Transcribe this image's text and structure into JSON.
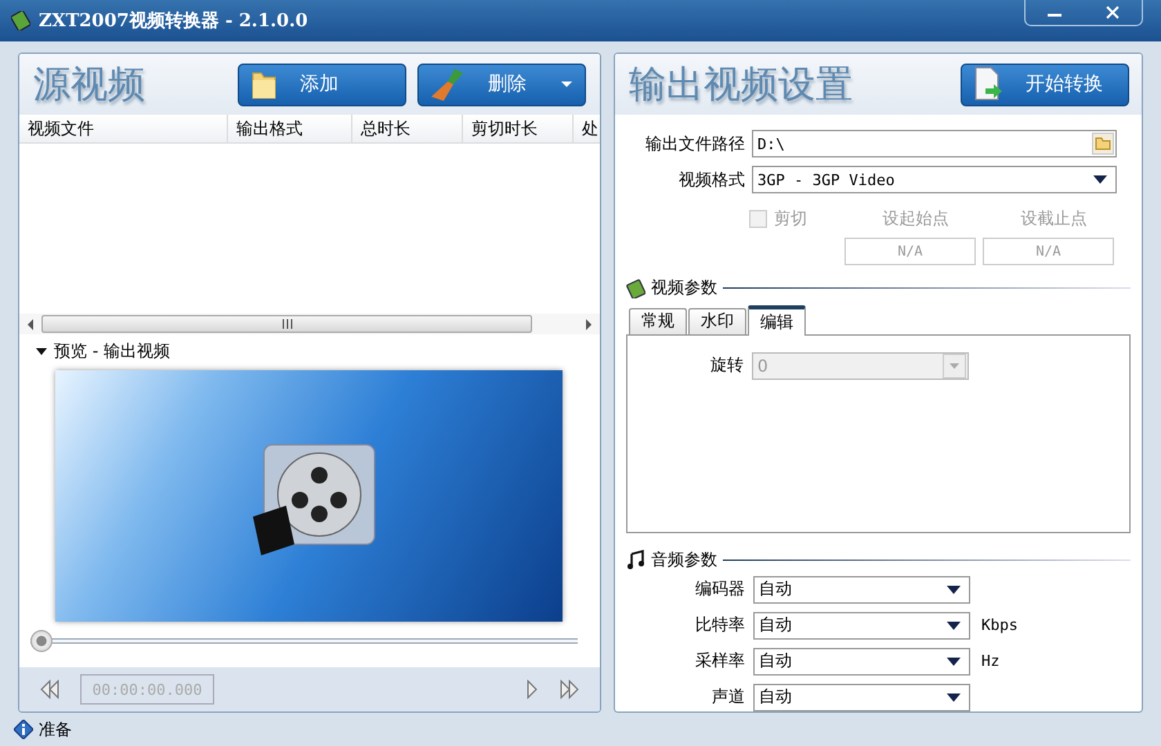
{
  "window": {
    "title": "ZXT2007视频转换器 - 2.1.0.0"
  },
  "source": {
    "title": "源视频",
    "buttons": [
      {
        "label": "添加",
        "kind": "add"
      },
      {
        "label": "删除",
        "kind": "delete"
      }
    ],
    "table": {
      "columns": [
        "视频文件",
        "输出格式",
        "总时长",
        "剪切时长",
        "处"
      ]
    },
    "preview": {
      "label": "预览 - 输出视频",
      "expanded": true,
      "seek": {
        "level": 0
      },
      "time": "00:00:00.000"
    }
  },
  "output": {
    "title": "输出视频设置",
    "start_button": "开始转换",
    "path": {
      "label": "输出文件路径",
      "value": "D:\\"
    },
    "format": {
      "label": "视频格式",
      "value": "3GP - 3GP Video"
    },
    "trim": {
      "label": "剪切",
      "checked": false,
      "disabled": true
    },
    "set_start": {
      "label": "设起始点",
      "value": "N/A"
    },
    "set_end": {
      "label": "设截止点",
      "value": "N/A"
    },
    "video_params": {
      "title": "视频参数",
      "tabs": [
        {
          "label": "常规",
          "selected": false
        },
        {
          "label": "水印",
          "selected": false
        },
        {
          "label": "编辑",
          "selected": true
        }
      ],
      "rotate": {
        "label": "旋转",
        "value": "0",
        "disabled": true
      }
    },
    "audio_params": {
      "title": "音频参数",
      "rows": [
        {
          "label": "编码器",
          "value": "自动"
        },
        {
          "label": "比特率",
          "value": "自动",
          "unit": "Kbps"
        },
        {
          "label": "采样率",
          "value": "自动",
          "unit": "Hz"
        },
        {
          "label": "声道",
          "value": "自动"
        }
      ]
    }
  },
  "status_bar": {
    "text": "准备"
  }
}
